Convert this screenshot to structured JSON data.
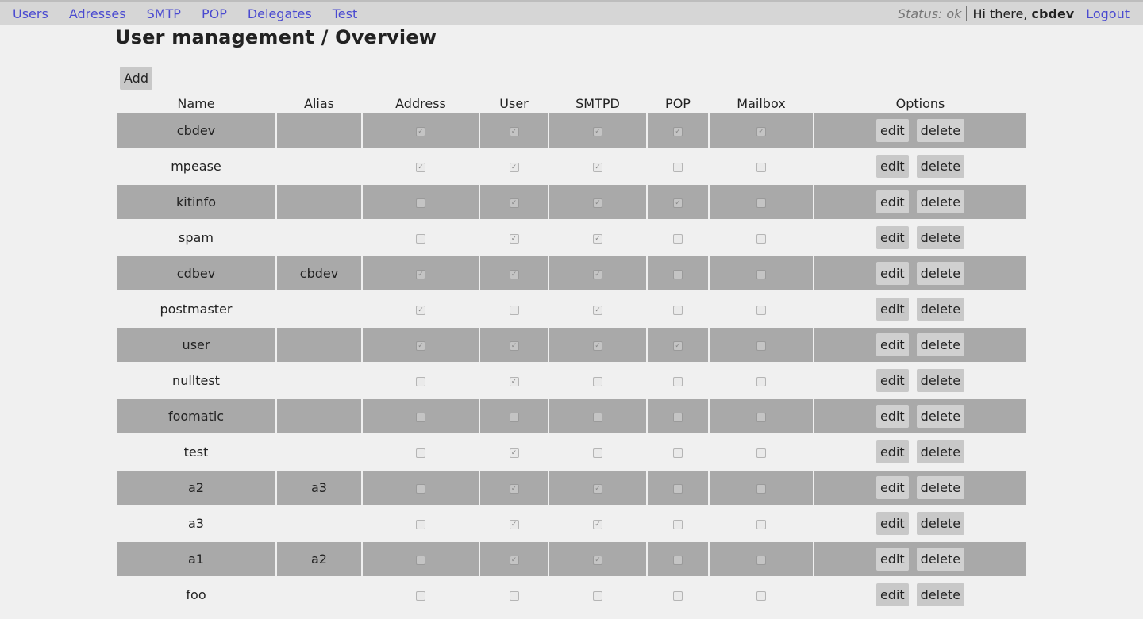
{
  "nav": {
    "items": [
      "Users",
      "Adresses",
      "SMTP",
      "POP",
      "Delegates",
      "Test"
    ],
    "status_label": "Status:",
    "status_value": "ok",
    "greeting": "Hi there,",
    "username": "cbdev",
    "logout": "Logout"
  },
  "page": {
    "title": "User management / Overview",
    "add_label": "Add"
  },
  "table": {
    "columns": [
      "Name",
      "Alias",
      "Address",
      "User",
      "SMTPD",
      "POP",
      "Mailbox",
      "Options"
    ],
    "edit_label": "edit",
    "delete_label": "delete",
    "rows": [
      {
        "name": "cbdev",
        "alias": "",
        "address": true,
        "user": true,
        "smtpd": true,
        "pop": true,
        "mailbox": true
      },
      {
        "name": "mpease",
        "alias": "",
        "address": true,
        "user": true,
        "smtpd": true,
        "pop": false,
        "mailbox": false
      },
      {
        "name": "kitinfo",
        "alias": "",
        "address": false,
        "user": true,
        "smtpd": true,
        "pop": true,
        "mailbox": false
      },
      {
        "name": "spam",
        "alias": "",
        "address": false,
        "user": true,
        "smtpd": true,
        "pop": false,
        "mailbox": false
      },
      {
        "name": "cdbev",
        "alias": "cbdev",
        "address": true,
        "user": true,
        "smtpd": true,
        "pop": false,
        "mailbox": false
      },
      {
        "name": "postmaster",
        "alias": "",
        "address": true,
        "user": false,
        "smtpd": true,
        "pop": false,
        "mailbox": false
      },
      {
        "name": "user",
        "alias": "",
        "address": true,
        "user": true,
        "smtpd": true,
        "pop": true,
        "mailbox": false
      },
      {
        "name": "nulltest",
        "alias": "",
        "address": false,
        "user": true,
        "smtpd": false,
        "pop": false,
        "mailbox": false
      },
      {
        "name": "foomatic",
        "alias": "",
        "address": false,
        "user": false,
        "smtpd": false,
        "pop": false,
        "mailbox": false
      },
      {
        "name": "test",
        "alias": "",
        "address": false,
        "user": true,
        "smtpd": false,
        "pop": false,
        "mailbox": false
      },
      {
        "name": "a2",
        "alias": "a3",
        "address": false,
        "user": true,
        "smtpd": true,
        "pop": false,
        "mailbox": false
      },
      {
        "name": "a3",
        "alias": "",
        "address": false,
        "user": true,
        "smtpd": true,
        "pop": false,
        "mailbox": false
      },
      {
        "name": "a1",
        "alias": "a2",
        "address": false,
        "user": true,
        "smtpd": true,
        "pop": false,
        "mailbox": false
      },
      {
        "name": "foo",
        "alias": "",
        "address": false,
        "user": false,
        "smtpd": false,
        "pop": false,
        "mailbox": false
      }
    ]
  }
}
